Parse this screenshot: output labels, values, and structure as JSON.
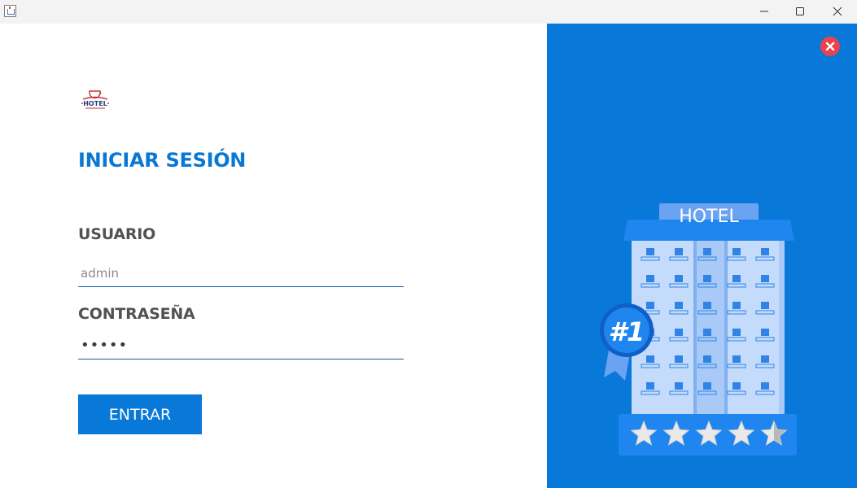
{
  "window": {
    "icon": "java-cup-icon",
    "controls": [
      "minimize-icon",
      "maximize-icon",
      "close-icon"
    ]
  },
  "login": {
    "logo_text": "HOTEL",
    "title": "INICIAR SESIÓN",
    "username_label": "USUARIO",
    "username_value": "admin",
    "password_label": "CONTRASEÑA",
    "password_value": "•••••",
    "submit_label": "ENTRAR"
  },
  "illustration": {
    "sign_text": "HOTEL",
    "rank_badge": "#1",
    "stars_rating": 4.5,
    "stars_total": 5
  },
  "colors": {
    "accent": "#0878d9",
    "title": "#0a77d4",
    "label": "#525252",
    "close_badge": "#e8424f",
    "panel_background": "#0878d9"
  }
}
